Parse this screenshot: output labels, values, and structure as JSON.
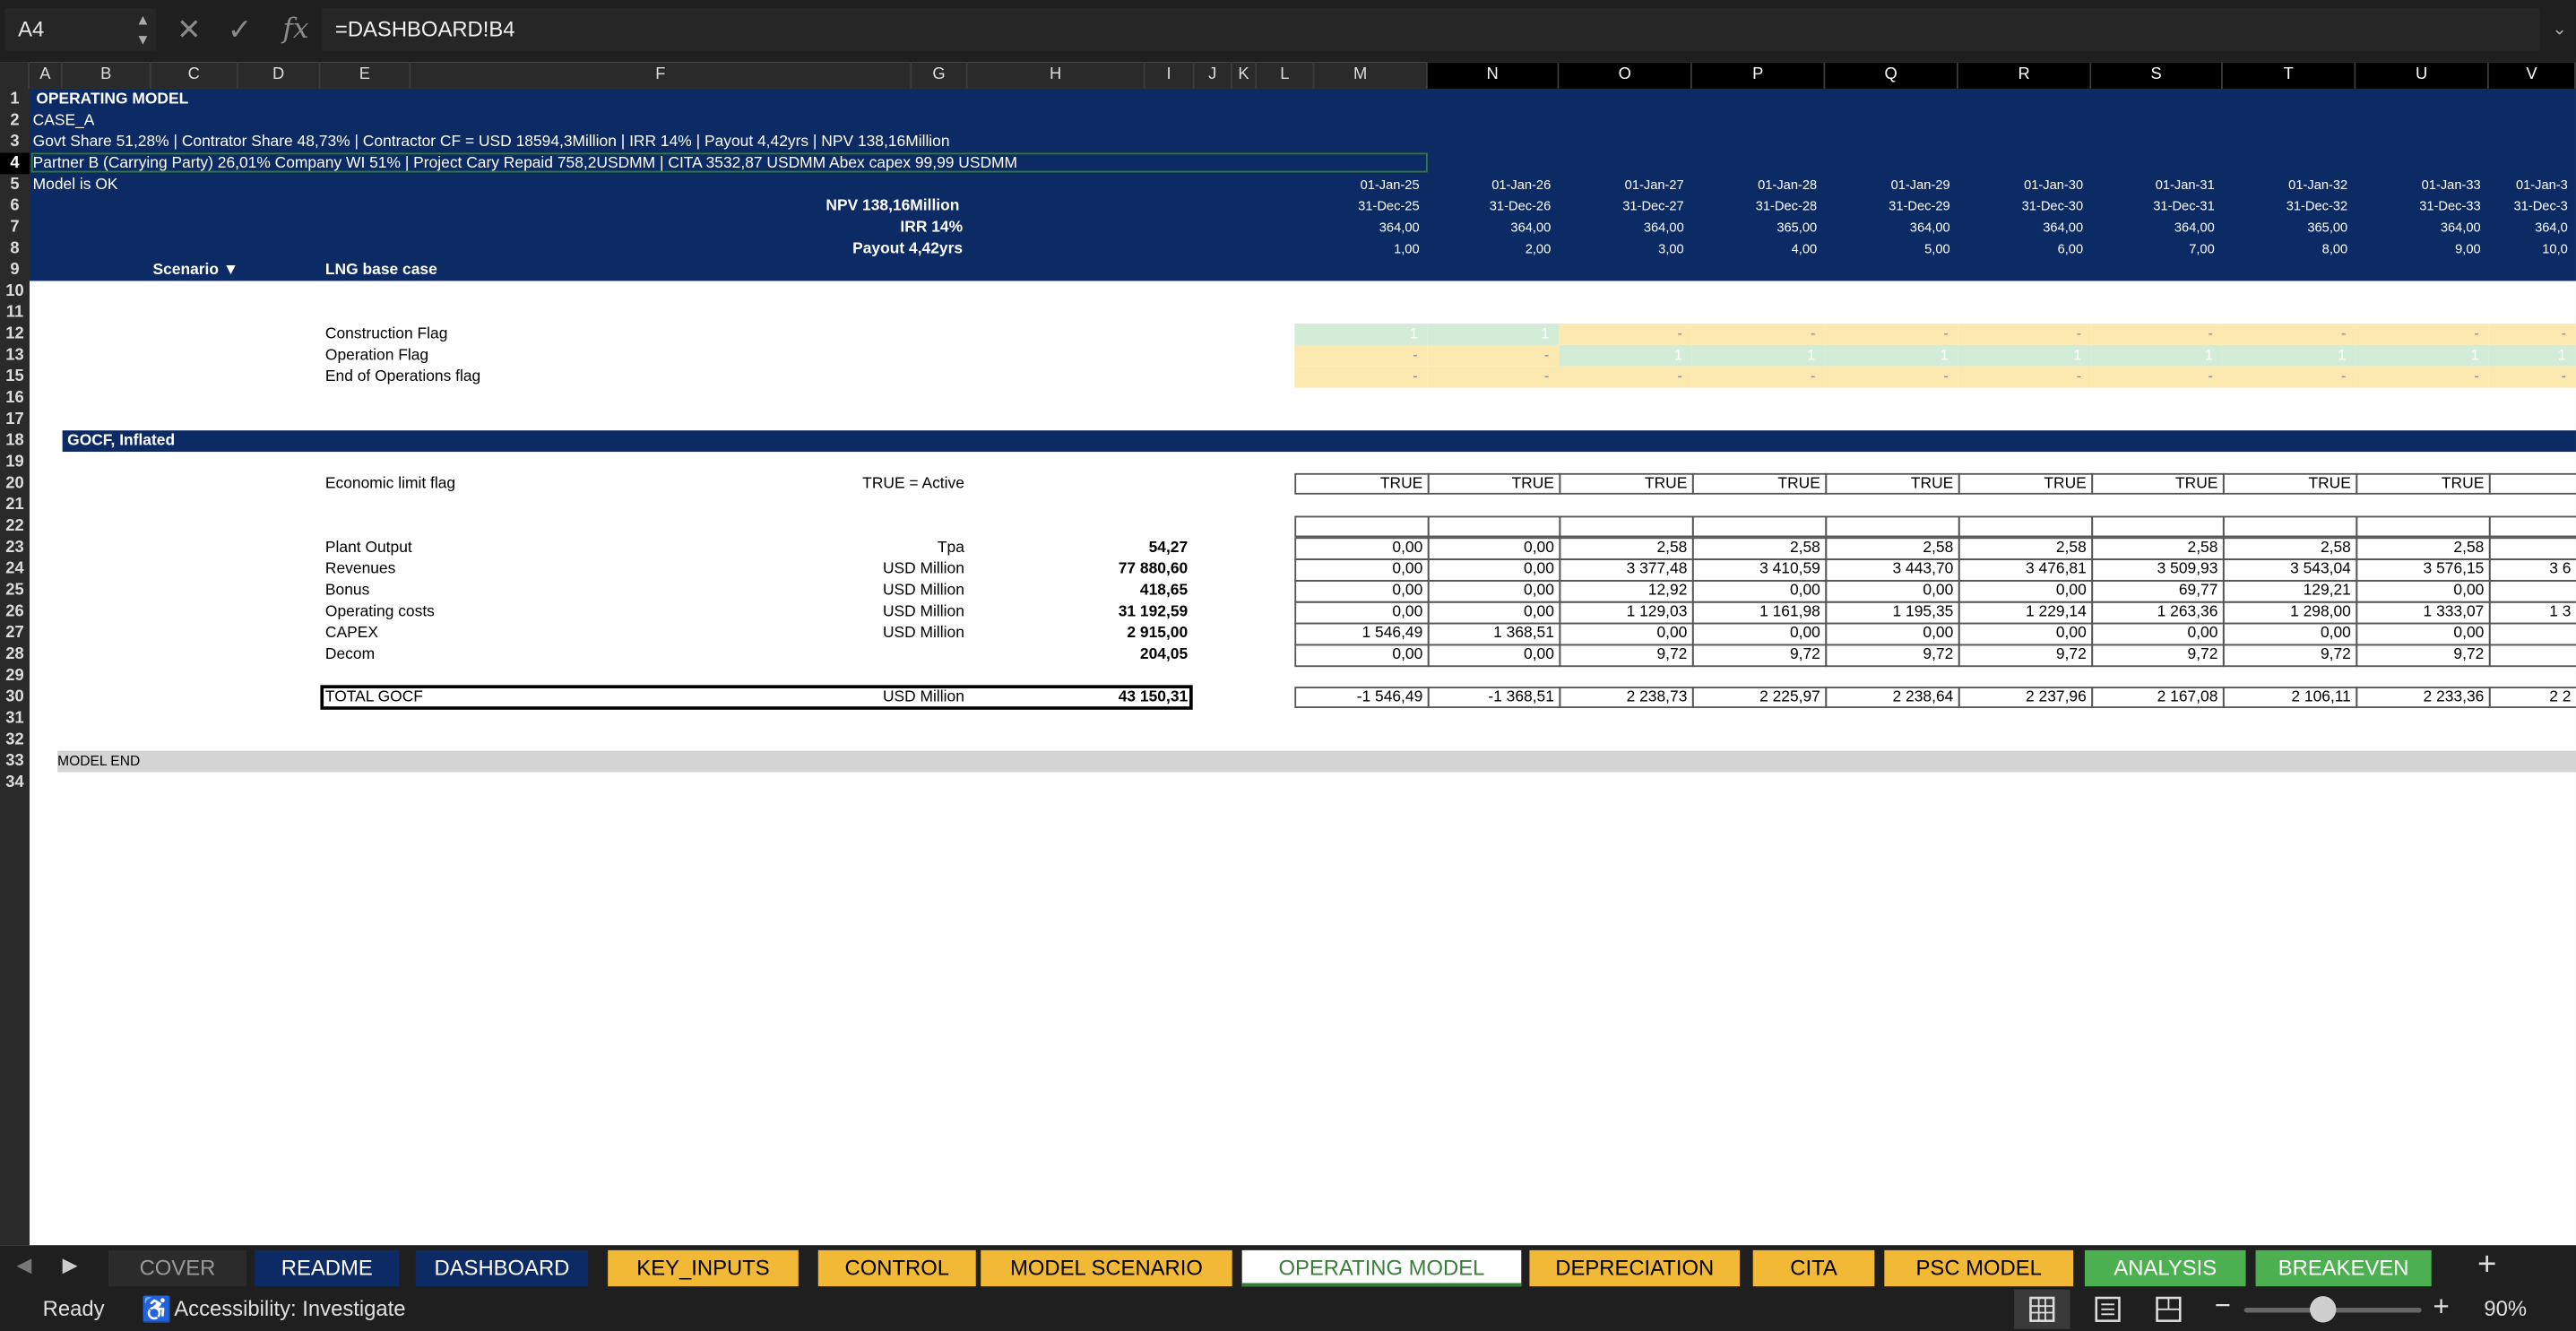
{
  "formula_bar": {
    "cell_ref": "A4",
    "formula": "=DASHBOARD!B4",
    "cancel_icon": "x-icon",
    "enter_icon": "check-icon",
    "fx_label": "fx"
  },
  "columns": [
    "A",
    "B",
    "C",
    "D",
    "E",
    "F",
    "G",
    "H",
    "I",
    "J",
    "K",
    "L",
    "M",
    "N",
    "O",
    "P",
    "Q",
    "R",
    "S",
    "T",
    "U",
    "V"
  ],
  "rows": [
    "1",
    "2",
    "3",
    "4",
    "5",
    "6",
    "7",
    "8",
    "9",
    "10",
    "11",
    "12",
    "13",
    "15",
    "16",
    "17",
    "18",
    "19",
    "20",
    "21",
    "22",
    "23",
    "24",
    "25",
    "26",
    "27",
    "28",
    "29",
    "30",
    "31",
    "32",
    "33",
    "34"
  ],
  "header": {
    "title": "OPERATING MODEL",
    "case": "CASE_A",
    "summary": "Govt Share 51,28%  |  Contrator Share 48,73%  |   Contractor CF = USD 18594,3Million |  IRR 14%  |  Payout 4,42yrs  |  NPV 138,16Million",
    "partner": "Partner B (Carrying Party) 26,01% Company WI 51%  |   Project Cary Repaid  758,2USDMM   |   CITA 3532,87  USDMM Abex capex 99,99  USDMM",
    "status": "Model is OK",
    "npv": "NPV 138,16Million",
    "irr": "IRR 14%",
    "payout": "Payout 4,42yrs",
    "scenario_label": "Scenario ▼",
    "scenario_value": "LNG base case"
  },
  "periods": {
    "start": [
      "01-Jan-25",
      "01-Jan-26",
      "01-Jan-27",
      "01-Jan-28",
      "01-Jan-29",
      "01-Jan-30",
      "01-Jan-31",
      "01-Jan-32",
      "01-Jan-33",
      "01-Jan-3"
    ],
    "end": [
      "31-Dec-25",
      "31-Dec-26",
      "31-Dec-27",
      "31-Dec-28",
      "31-Dec-29",
      "31-Dec-30",
      "31-Dec-31",
      "31-Dec-32",
      "31-Dec-33",
      "31-Dec-3"
    ],
    "days": [
      "364,00",
      "364,00",
      "364,00",
      "365,00",
      "364,00",
      "364,00",
      "364,00",
      "365,00",
      "364,00",
      "364,0"
    ],
    "index": [
      "1,00",
      "2,00",
      "3,00",
      "4,00",
      "5,00",
      "6,00",
      "7,00",
      "8,00",
      "9,00",
      "10,0"
    ]
  },
  "flags": {
    "construction": {
      "label": "Construction Flag",
      "values": [
        "1",
        "1",
        "-",
        "-",
        "-",
        "-",
        "-",
        "-",
        "-",
        "-"
      ]
    },
    "operation": {
      "label": "Operation Flag",
      "values": [
        "-",
        "-",
        "1",
        "1",
        "1",
        "1",
        "1",
        "1",
        "1",
        "1"
      ]
    },
    "end_ops": {
      "label": "End of Operations flag",
      "values": [
        "-",
        "-",
        "-",
        "-",
        "-",
        "-",
        "-",
        "-",
        "-",
        "-"
      ]
    }
  },
  "section_title": "GOCF, Inflated",
  "economic_limit": {
    "label": "Economic limit flag",
    "note": "TRUE = Active",
    "values": [
      "TRUE",
      "TRUE",
      "TRUE",
      "TRUE",
      "TRUE",
      "TRUE",
      "TRUE",
      "TRUE",
      "TRUE",
      ""
    ]
  },
  "table": [
    {
      "label": "Plant Output",
      "unit": "Tpa",
      "total": "54,27",
      "values": [
        "0,00",
        "0,00",
        "2,58",
        "2,58",
        "2,58",
        "2,58",
        "2,58",
        "2,58",
        "2,58",
        ""
      ]
    },
    {
      "label": " Revenues",
      "unit": "USD Million",
      "total": "77 880,60",
      "values": [
        "0,00",
        "0,00",
        "3 377,48",
        "3 410,59",
        "3 443,70",
        "3 476,81",
        "3 509,93",
        "3 543,04",
        "3 576,15",
        "3 6"
      ]
    },
    {
      "label": "Bonus",
      "unit": "USD Million",
      "total": "418,65",
      "values": [
        "0,00",
        "0,00",
        "12,92",
        "0,00",
        "0,00",
        "0,00",
        "69,77",
        "129,21",
        "0,00",
        ""
      ]
    },
    {
      "label": "Operating costs",
      "unit": "USD Million",
      "total": "31 192,59",
      "values": [
        "0,00",
        "0,00",
        "1 129,03",
        "1 161,98",
        "1 195,35",
        "1 229,14",
        "1 263,36",
        "1 298,00",
        "1 333,07",
        "1 3"
      ]
    },
    {
      "label": "CAPEX",
      "unit": "USD Million",
      "total": "2 915,00",
      "values": [
        "1 546,49",
        "1 368,51",
        "0,00",
        "0,00",
        "0,00",
        "0,00",
        "0,00",
        "0,00",
        "0,00",
        ""
      ]
    },
    {
      "label": "Decom",
      "unit": "",
      "total": "204,05",
      "values": [
        "0,00",
        "0,00",
        "9,72",
        "9,72",
        "9,72",
        "9,72",
        "9,72",
        "9,72",
        "9,72",
        ""
      ]
    }
  ],
  "total_gocf": {
    "label": "TOTAL GOCF",
    "unit": "USD Million",
    "total": "43 150,31",
    "values": [
      "-1 546,49",
      "-1 368,51",
      "2 238,73",
      "2 225,97",
      "2 238,64",
      "2 237,96",
      "2 167,08",
      "2 106,11",
      "2 233,36",
      "2 2"
    ]
  },
  "model_end": "MODEL END",
  "tabs": [
    {
      "label": "COVER",
      "bg": "#2b2b2b",
      "fg": "#9a9a9a"
    },
    {
      "label": "README",
      "bg": "#0c2a63",
      "fg": "#ffffff"
    },
    {
      "label": "DASHBOARD",
      "bg": "#0c2a63",
      "fg": "#ffffff"
    },
    {
      "label": "KEY_INPUTS",
      "bg": "#f2b936",
      "fg": "#000000"
    },
    {
      "label": "CONTROL",
      "bg": "#f2b936",
      "fg": "#000000"
    },
    {
      "label": "MODEL SCENARIO",
      "bg": "#f2b936",
      "fg": "#000000"
    },
    {
      "label": "OPERATING MODEL",
      "bg": "#ffffff",
      "fg": "#3a7d3a"
    },
    {
      "label": "DEPRECIATION",
      "bg": "#f2b936",
      "fg": "#000000"
    },
    {
      "label": "CITA",
      "bg": "#f2b936",
      "fg": "#000000"
    },
    {
      "label": "PSC MODEL",
      "bg": "#f2b936",
      "fg": "#000000"
    },
    {
      "label": "ANALYSIS",
      "bg": "#4caf50",
      "fg": "#ffffff"
    },
    {
      "label": "BREAKEVEN",
      "bg": "#4caf50",
      "fg": "#ffffff"
    }
  ],
  "status_bar": {
    "ready": "Ready",
    "accessibility": "Accessibility: Investigate",
    "zoom": "90%"
  },
  "colors": {
    "navy": "#0c2a63",
    "flag_green": "#d3ecd7",
    "flag_yellow": "#fbe9b0",
    "tab_orange": "#f2b936",
    "tab_green": "#4caf50"
  }
}
